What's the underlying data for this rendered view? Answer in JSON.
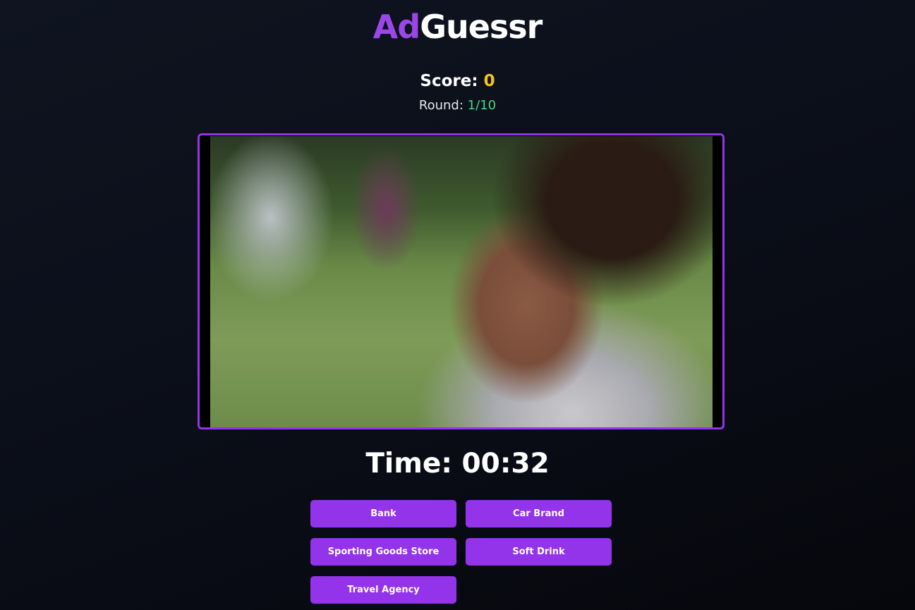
{
  "header": {
    "title_part1": "Ad",
    "title_part2": "Guessr",
    "brand_color": "#9b47e8"
  },
  "stats": {
    "score_label": "Score:",
    "score_value": "0",
    "round_label": "Round:",
    "round_value": "1/10"
  },
  "video": {
    "description_icon": "video-player",
    "frame_color": "#9333ea"
  },
  "timer": {
    "text": "Time: 00:32"
  },
  "answers": [
    {
      "label": "Bank"
    },
    {
      "label": "Car Brand"
    },
    {
      "label": "Sporting Goods Store"
    },
    {
      "label": "Soft Drink"
    },
    {
      "label": "Travel Agency"
    }
  ],
  "colors": {
    "accent": "#9333ea",
    "score": "#f5c518",
    "round": "#3ddc84"
  }
}
